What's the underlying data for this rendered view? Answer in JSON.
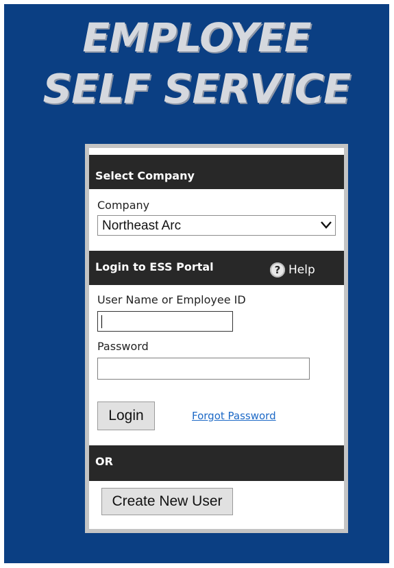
{
  "header": {
    "title_line1": "EMPLOYEE",
    "title_line2": "SELF SERVICE"
  },
  "company_section": {
    "title": "Select Company",
    "field_label": "Company",
    "selected_value": "Northeast Arc"
  },
  "login_section": {
    "title": "Login to ESS Portal",
    "help_label": "Help",
    "help_icon": "?",
    "username_label": "User Name or Employee ID",
    "username_value": "",
    "password_label": "Password",
    "password_value": "",
    "login_button": "Login",
    "forgot_link": "Forgot Password"
  },
  "or_section": {
    "title": "OR",
    "create_button": "Create New User"
  },
  "colors": {
    "background": "#0b3f83",
    "section_bar": "#282828",
    "link": "#1b68c6"
  }
}
